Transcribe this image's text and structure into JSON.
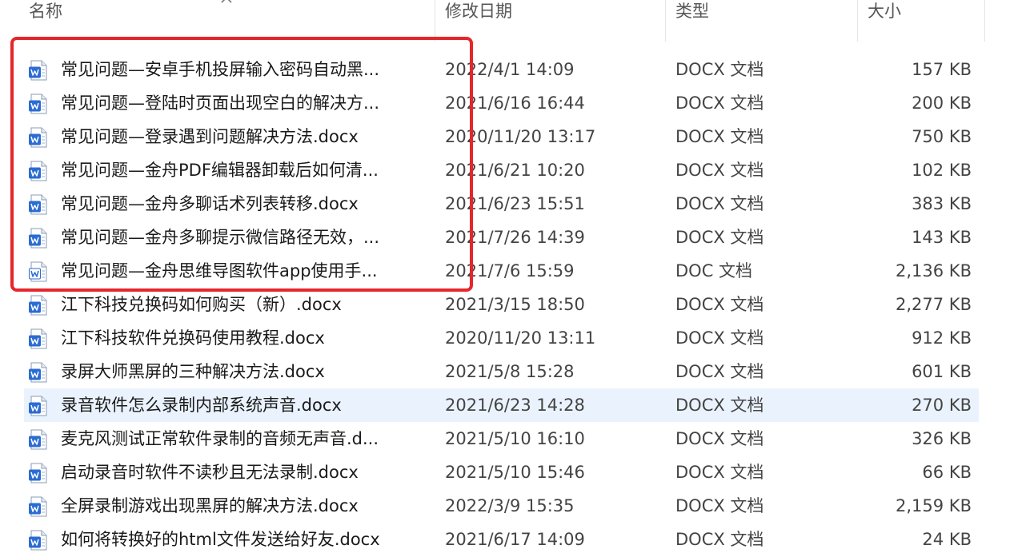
{
  "columns": {
    "name": "名称",
    "date": "修改日期",
    "type": "类型",
    "size": "大小"
  },
  "icons": {
    "docx": "word-docx-icon",
    "doc": "word-doc-icon",
    "sort": "sort-up-chevron-icon"
  },
  "colors": {
    "accent": "#2b6cd4",
    "highlight_border": "#e5262b",
    "hover_row": "#eaf3fd"
  },
  "files": [
    {
      "name": "常见问题—安卓手机投屏输入密码自动黑...",
      "date": "2022/4/1 14:09",
      "type": "DOCX 文档",
      "size": "157 KB",
      "icon": "docx"
    },
    {
      "name": "常见问题—登陆时页面出现空白的解决方...",
      "date": "2021/6/16 16:44",
      "type": "DOCX 文档",
      "size": "200 KB",
      "icon": "docx"
    },
    {
      "name": "常见问题—登录遇到问题解决方法.docx",
      "date": "2020/11/20 13:17",
      "type": "DOCX 文档",
      "size": "750 KB",
      "icon": "docx"
    },
    {
      "name": "常见问题—金舟PDF编辑器卸载后如何清...",
      "date": "2021/6/21 10:20",
      "type": "DOCX 文档",
      "size": "102 KB",
      "icon": "docx"
    },
    {
      "name": "常见问题—金舟多聊话术列表转移.docx",
      "date": "2021/6/23 15:51",
      "type": "DOCX 文档",
      "size": "383 KB",
      "icon": "docx"
    },
    {
      "name": "常见问题—金舟多聊提示微信路径无效，...",
      "date": "2021/7/26 14:39",
      "type": "DOCX 文档",
      "size": "143 KB",
      "icon": "docx"
    },
    {
      "name": "常见问题—金舟思维导图软件app使用手...",
      "date": "2021/7/6 15:59",
      "type": "DOC 文档",
      "size": "2,136 KB",
      "icon": "doc"
    },
    {
      "name": "江下科技兑换码如何购买（新）.docx",
      "date": "2021/3/15 18:50",
      "type": "DOCX 文档",
      "size": "2,277 KB",
      "icon": "docx"
    },
    {
      "name": "江下科技软件兑换码使用教程.docx",
      "date": "2020/11/20 13:11",
      "type": "DOCX 文档",
      "size": "912 KB",
      "icon": "docx"
    },
    {
      "name": "录屏大师黑屏的三种解决方法.docx",
      "date": "2021/5/8 15:28",
      "type": "DOCX 文档",
      "size": "601 KB",
      "icon": "docx"
    },
    {
      "name": "录音软件怎么录制内部系统声音.docx",
      "date": "2021/6/23 14:28",
      "type": "DOCX 文档",
      "size": "270 KB",
      "icon": "docx",
      "hover": true
    },
    {
      "name": "麦克风测试正常软件录制的音频无声音.d...",
      "date": "2021/5/10 16:10",
      "type": "DOCX 文档",
      "size": "326 KB",
      "icon": "docx"
    },
    {
      "name": "启动录音时软件不读秒且无法录制.docx",
      "date": "2021/5/10 15:46",
      "type": "DOCX 文档",
      "size": "66 KB",
      "icon": "docx"
    },
    {
      "name": "全屏录制游戏出现黑屏的解决方法.docx",
      "date": "2022/3/9 15:35",
      "type": "DOCX 文档",
      "size": "2,159 KB",
      "icon": "docx"
    },
    {
      "name": "如何将转换好的html文件发送给好友.docx",
      "date": "2021/6/17 14:09",
      "type": "DOCX 文档",
      "size": "24 KB",
      "icon": "docx"
    }
  ]
}
